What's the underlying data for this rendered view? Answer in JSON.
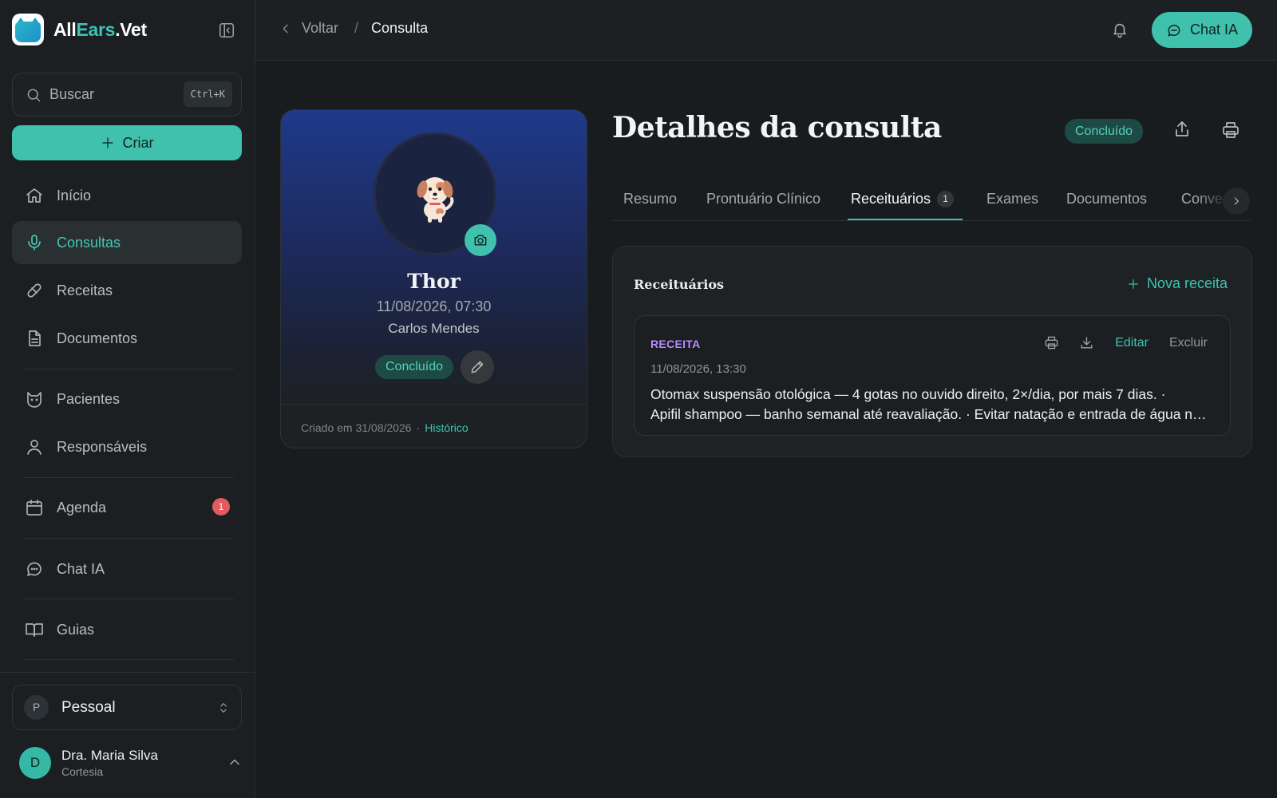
{
  "brand": {
    "name_part1": "All",
    "name_part2": "Ears",
    "name_part3": ".Vet"
  },
  "sidebar": {
    "search_label": "Buscar",
    "search_shortcut": "Ctrl+K",
    "create_label": "Criar",
    "items": [
      {
        "label": "Início",
        "icon": "home-icon"
      },
      {
        "label": "Consultas",
        "icon": "microphone-icon",
        "active": true
      },
      {
        "label": "Receitas",
        "icon": "pill-icon"
      },
      {
        "label": "Documentos",
        "icon": "file-icon"
      },
      {
        "label": "Pacientes",
        "icon": "cat-face-icon"
      },
      {
        "label": "Responsáveis",
        "icon": "user-icon"
      },
      {
        "label": "Agenda",
        "icon": "calendar-icon",
        "badge": "1"
      },
      {
        "label": "Chat IA",
        "icon": "chat-bubble-icon"
      },
      {
        "label": "Guias",
        "icon": "book-icon"
      }
    ],
    "workspace": {
      "initial": "P",
      "name": "Pessoal"
    },
    "user": {
      "initial": "D",
      "name": "Dra. Maria Silva",
      "org": "Cortesia"
    }
  },
  "topbar": {
    "back_label": "Voltar",
    "separator": "/",
    "current": "Consulta",
    "chat_label": "Chat IA"
  },
  "patient": {
    "name": "Thor",
    "datetime": "11/08/2026, 07:30",
    "owner": "Carlos Mendes",
    "status": "Concluído",
    "created": "Criado em 31/08/2026",
    "dot": "·",
    "history_label": "Histórico"
  },
  "main": {
    "title": "Detalhes da consulta",
    "status": "Concluído",
    "tabs": [
      {
        "label": "Resumo"
      },
      {
        "label": "Prontuário Clínico"
      },
      {
        "label": "Receituários",
        "badge": "1",
        "active": true
      },
      {
        "label": "Exames"
      },
      {
        "label": "Documentos"
      },
      {
        "label": "Conversa"
      }
    ],
    "panel": {
      "title": "Receituários",
      "new_label": "Nova receita",
      "prescription": {
        "tag": "RECEITA",
        "datetime": "11/08/2026, 13:30",
        "line1": "Otomax suspensão otológica — 4 gotas no ouvido direito, 2×/dia, por mais 7 dias. ·",
        "line2": "Apifil shampoo — banho semanal até reavaliação. · Evitar natação e entrada de água no ouvido.",
        "edit_label": "Editar",
        "delete_label": "Excluir"
      }
    }
  },
  "colors": {
    "accent": "#3fc1ad",
    "badge_red": "#e45a5e",
    "rx_tag": "#b78bff"
  }
}
